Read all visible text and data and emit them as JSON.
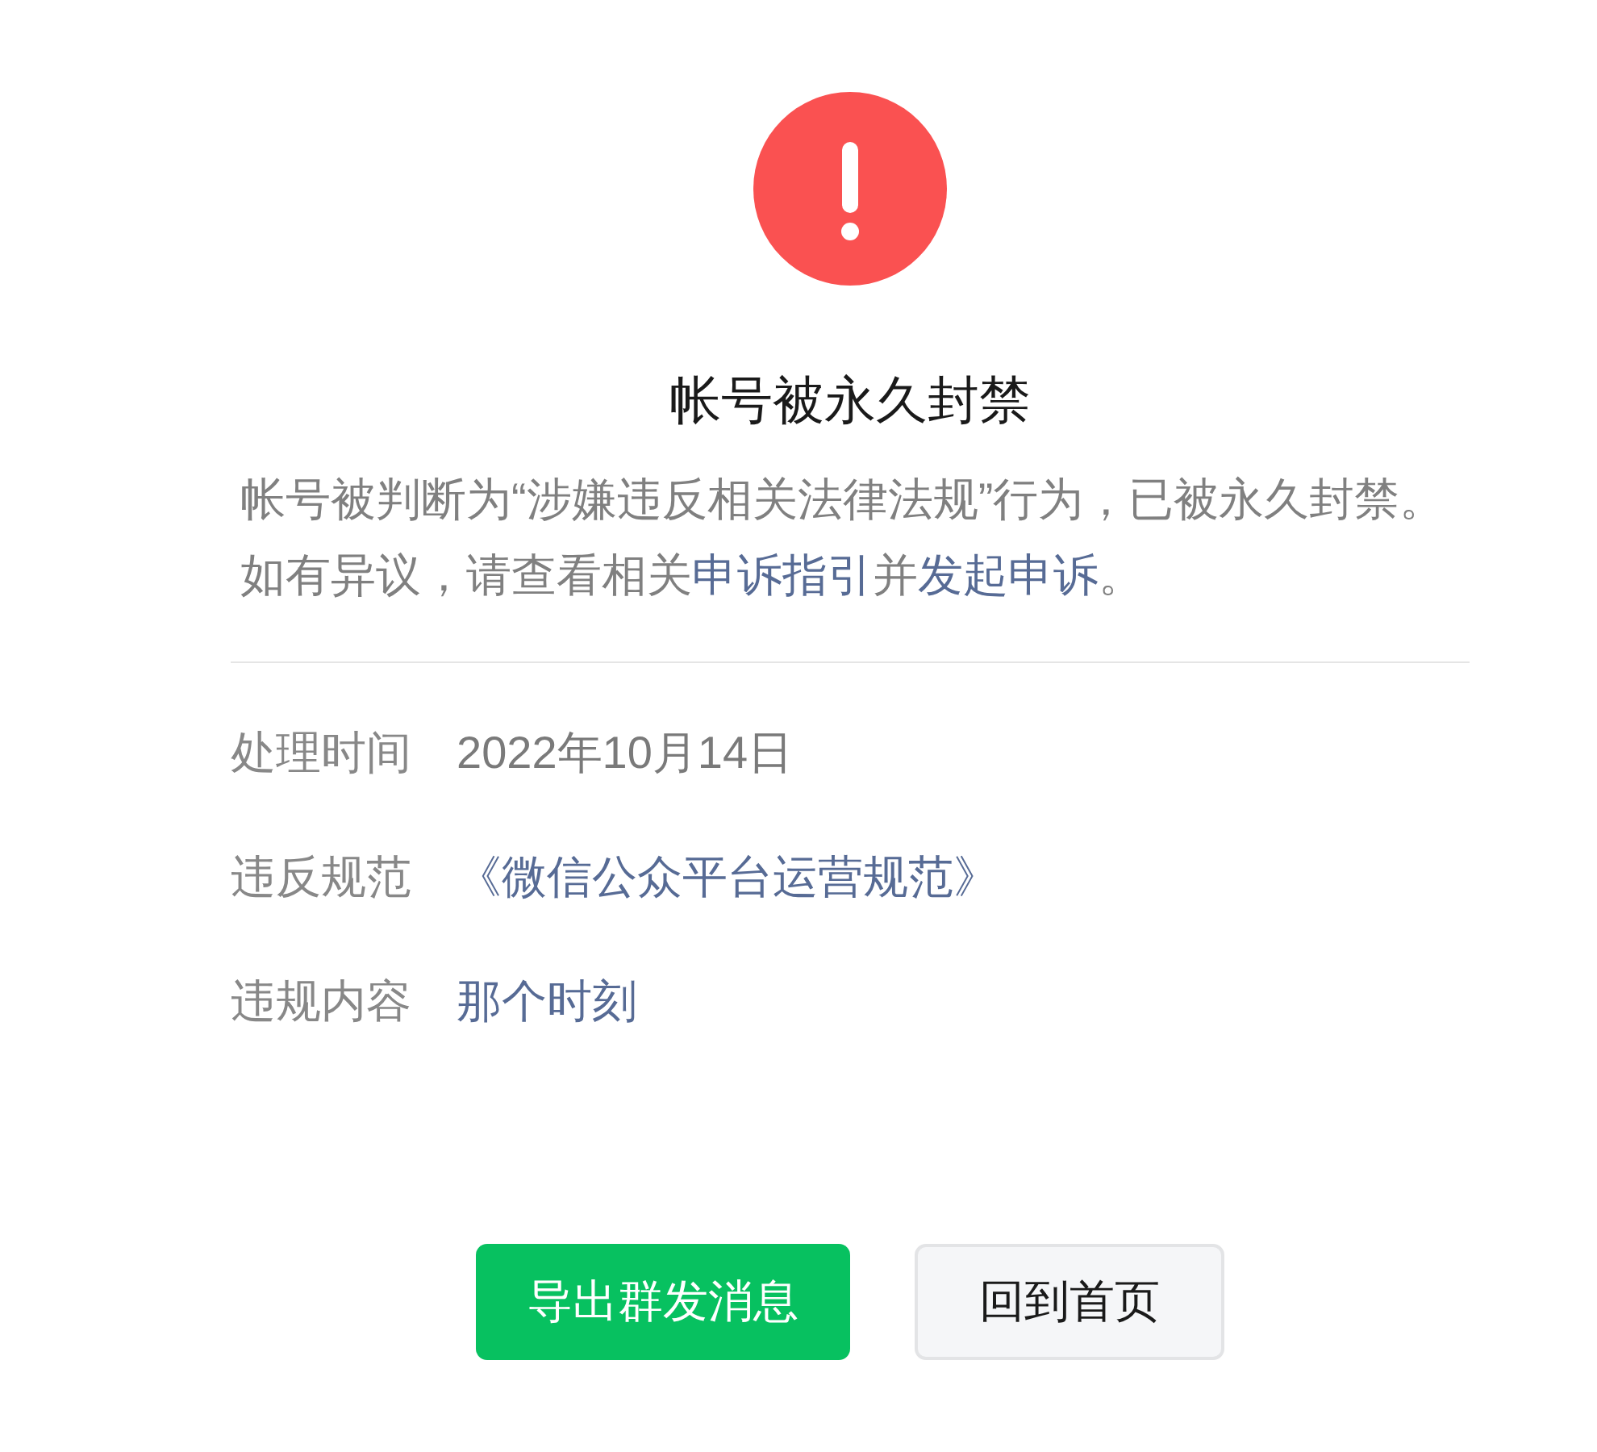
{
  "title": "帐号被永久封禁",
  "description": {
    "lines": [
      [
        {
          "kind": "text",
          "text": "帐号被判断为“涉嫌违反相关法律法规”行为，已被永久封禁。"
        }
      ],
      [
        {
          "kind": "text",
          "text": "如有异议，请查看相关"
        },
        {
          "kind": "link",
          "text": "申诉指引"
        },
        {
          "kind": "text",
          "text": "并"
        },
        {
          "kind": "link",
          "text": "发起申诉"
        },
        {
          "kind": "text",
          "text": "。"
        }
      ]
    ]
  },
  "details": [
    {
      "label": "处理时间",
      "value": "2022年10月14日",
      "kind": "text"
    },
    {
      "label": "违反规范",
      "value": "《微信公众平台运营规范》",
      "kind": "link"
    },
    {
      "label": "违规内容",
      "value": "那个时刻",
      "kind": "link"
    }
  ],
  "buttons": [
    {
      "label": "导出群发消息",
      "kind": "primary"
    },
    {
      "label": "回到首页",
      "kind": "default"
    }
  ]
}
